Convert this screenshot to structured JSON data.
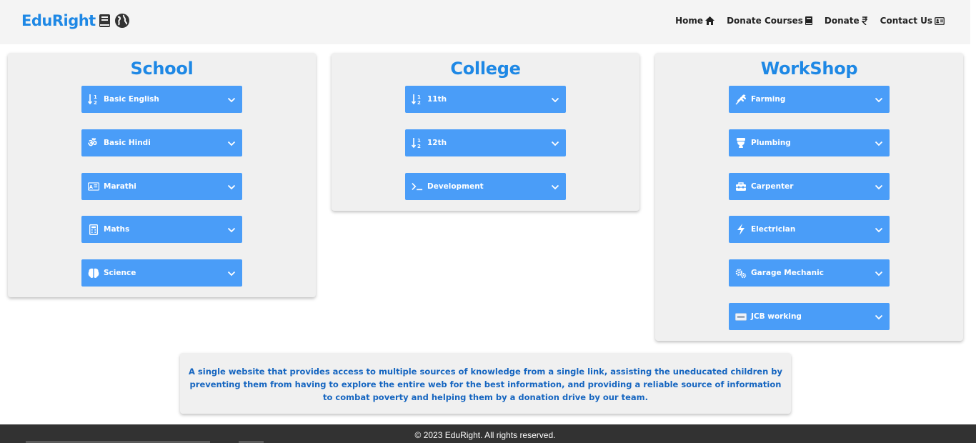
{
  "brand": {
    "name": "EduRight",
    "icons": [
      "book-icon",
      "globe-icon"
    ]
  },
  "nav": [
    {
      "label": "Home",
      "icon": "home-icon"
    },
    {
      "label": "Donate Courses",
      "icon": "book-icon"
    },
    {
      "label": "Donate",
      "icon": "rupee-icon"
    },
    {
      "label": "Contact Us",
      "icon": "contact-card-icon"
    }
  ],
  "sections": [
    {
      "title": "School",
      "items": [
        {
          "label": "Basic English",
          "icon": "sort-numeric-icon"
        },
        {
          "label": "Basic Hindi",
          "icon": "om-icon"
        },
        {
          "label": "Marathi",
          "icon": "id-card-icon"
        },
        {
          "label": "Maths",
          "icon": "calculator-icon"
        },
        {
          "label": "Science",
          "icon": "brain-icon"
        }
      ]
    },
    {
      "title": "College",
      "items": [
        {
          "label": "11th",
          "icon": "sort-numeric-icon"
        },
        {
          "label": "12th",
          "icon": "sort-numeric-icon"
        },
        {
          "label": "Development",
          "icon": "terminal-icon"
        }
      ]
    },
    {
      "title": "WorkShop",
      "items": [
        {
          "label": "Farming",
          "icon": "wheat-icon"
        },
        {
          "label": "Plumbing",
          "icon": "toilet-icon"
        },
        {
          "label": "Carpenter",
          "icon": "toolbox-icon"
        },
        {
          "label": "Electrician",
          "icon": "bolt-icon"
        },
        {
          "label": "Garage Mechanic",
          "icon": "gears-icon"
        },
        {
          "label": "JCB working",
          "icon": "jcb-icon"
        }
      ]
    }
  ],
  "about": {
    "text": "A single website that provides access to multiple sources of knowledge from a single link, assisting the uneducated children by preventing them from having to explore the entire web for the best information, and providing a reliable source of information to combat poverty and helping them by a donation drive by our team."
  },
  "footer": {
    "text": "© 2023 EduRight. All rights reserved."
  },
  "colors": {
    "brand": "#1e88e5",
    "accordion": "#4a9df8",
    "card": "#f0f0f0",
    "footer": "#323232",
    "about_text": "#1565c0"
  }
}
